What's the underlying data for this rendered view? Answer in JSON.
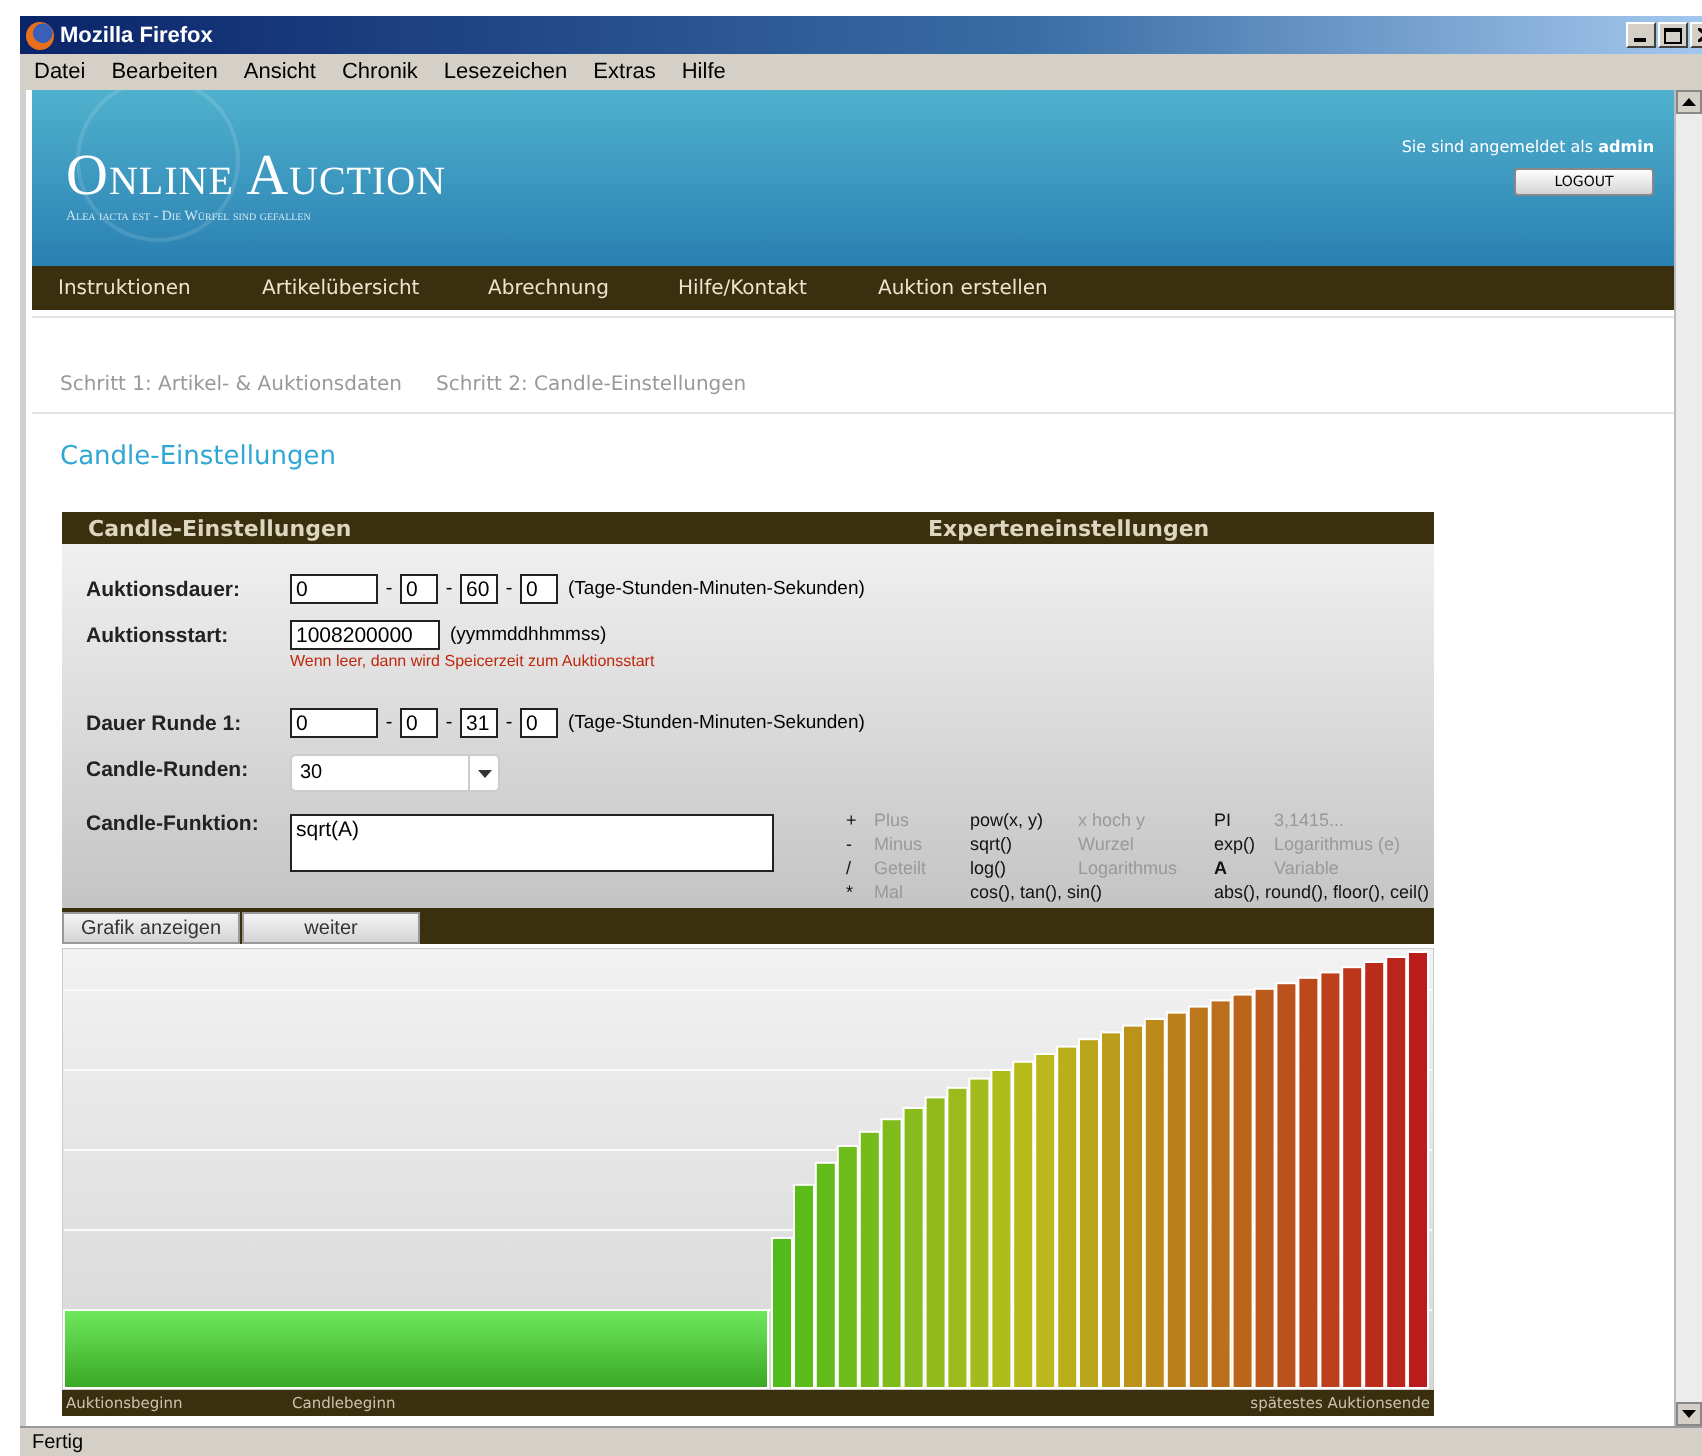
{
  "window": {
    "title": "Mozilla Firefox"
  },
  "menu": [
    "Datei",
    "Bearbeiten",
    "Ansicht",
    "Chronik",
    "Lesezeichen",
    "Extras",
    "Hilfe"
  ],
  "header": {
    "logo": "Online Auction",
    "tagline": "Alea iacta est - Die Würfel sind gefallen",
    "login_text": "Sie sind angemeldet als **admin**",
    "logout": "LOGOUT"
  },
  "nav": [
    "Instruktionen",
    "Artikelübersicht",
    "Abrechnung",
    "Hilfe/Kontakt",
    "Auktion erstellen"
  ],
  "steps": [
    "Schritt 1: Artikel- & Auktionsdaten",
    "Schritt 2: Candle-Einstellungen"
  ],
  "page_title": "Candle-Einstellungen",
  "panel": {
    "title": "Candle-Einstellungen",
    "expert_title": "Experteneinstellungen",
    "rows": [
      {
        "kind": "duration",
        "label": "Auktionsdauer:",
        "values": [
          "0",
          "0",
          "60",
          "0"
        ],
        "separator": "-",
        "hint": "(Tage-Stunden-Minuten-Sekunden)"
      },
      {
        "kind": "date",
        "label": "Auktionsstart:",
        "value": "1008200000",
        "hint": "(yymmddhhmmss)",
        "note": "Wenn leer, dann wird Speicerzeit zum Auktionsstart"
      },
      {
        "kind": "duration",
        "label": "Dauer Runde 1:",
        "values": [
          "0",
          "0",
          "31",
          "0"
        ],
        "separator": "-",
        "hint": "(Tage-Stunden-Minuten-Sekunden)"
      },
      {
        "kind": "select",
        "label": "Candle-Runden:",
        "value": "30"
      },
      {
        "kind": "textarea",
        "label": "Candle-Funktion:",
        "value": "sqrt(A)"
      }
    ],
    "legend": [
      [
        {
          "name": "+",
          "meaning": "Plus"
        },
        {
          "name": "pow(x, y)",
          "meaning": "x hoch y"
        },
        {
          "name": "PI",
          "meaning": "3,1415..."
        }
      ],
      [
        {
          "name": "-",
          "meaning": "Minus"
        },
        {
          "name": "sqrt()",
          "meaning": "Wurzel"
        },
        {
          "name": "exp()",
          "meaning": "Logarithmus (e)"
        }
      ],
      [
        {
          "name": "/",
          "meaning": "Geteilt"
        },
        {
          "name": "log()",
          "meaning": "Logarithmus"
        },
        {
          "name": "A",
          "meaning": "Variable",
          "bold": true
        }
      ],
      [
        {
          "name": "*",
          "meaning": "Mal"
        },
        {
          "name": "cos(), tan(), sin()"
        },
        {
          "name": "abs(), round(), floor(), ceil()"
        }
      ]
    ],
    "buttons": [
      "Grafik anzeigen",
      "weiter"
    ]
  },
  "chart": {
    "labels": [
      "Auktionsbeginn",
      "Candlebeginn",
      "spätestes Auktionsende"
    ]
  },
  "status_bar": "Fertig"
}
